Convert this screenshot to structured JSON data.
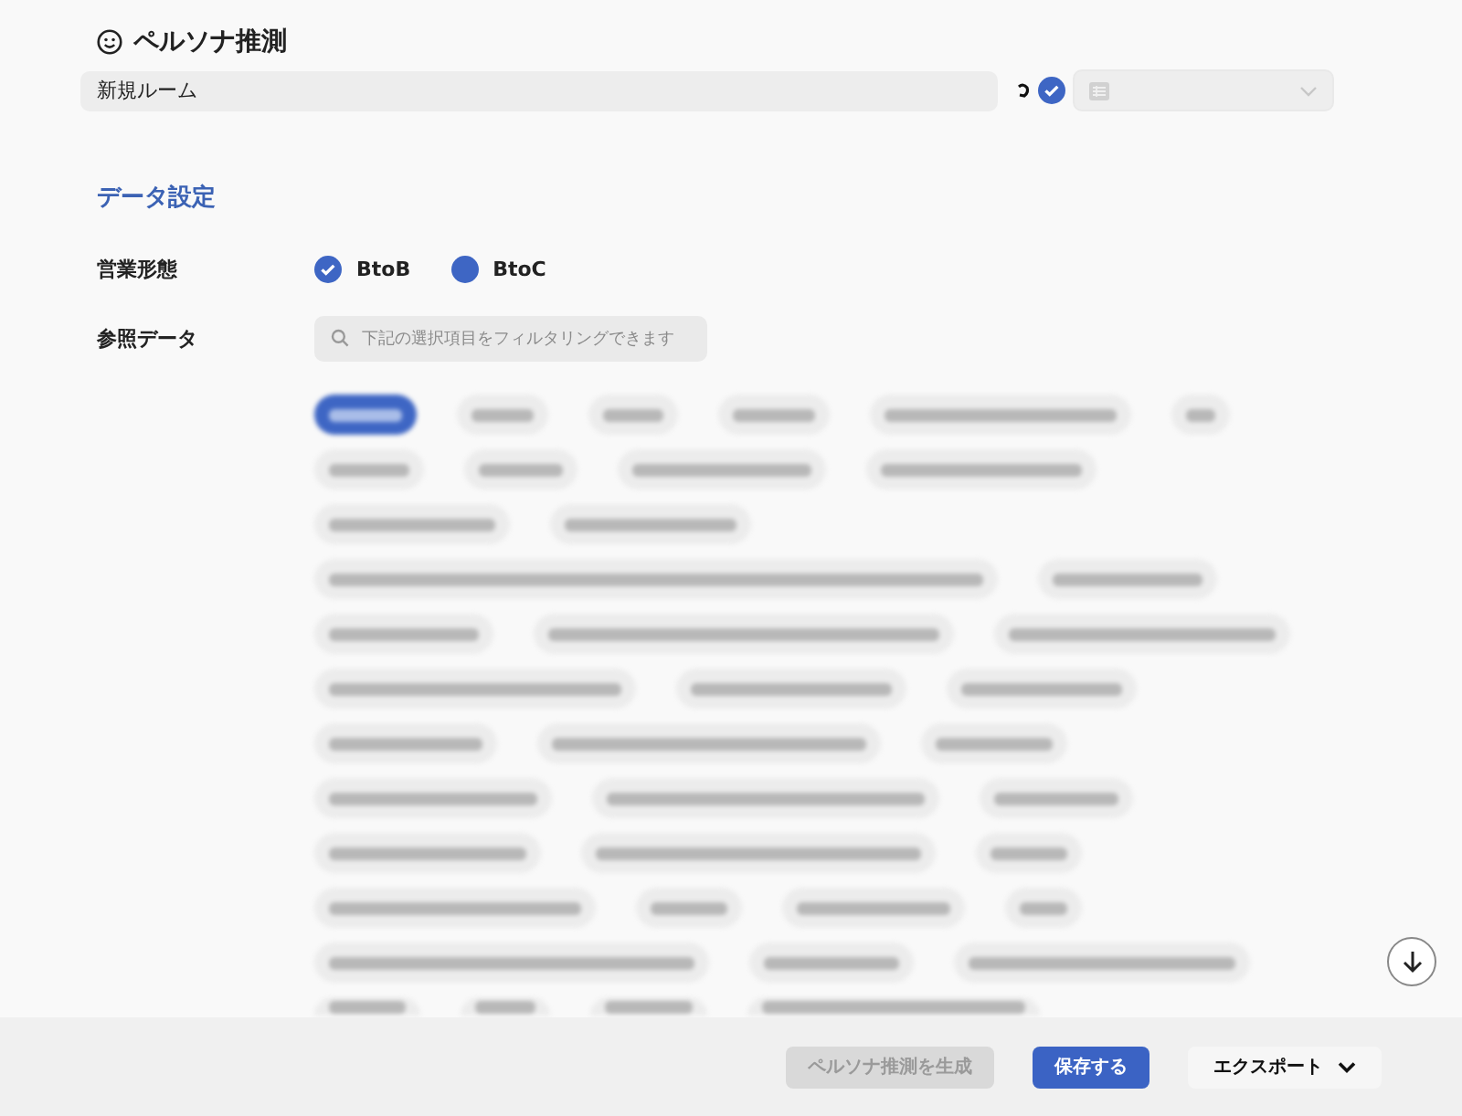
{
  "header": {
    "title": "ペルソナ推測"
  },
  "room_name": {
    "value": "新規ルーム"
  },
  "room_select": {
    "disabled": true
  },
  "data_settings": {
    "heading": "データ設定",
    "business_type": {
      "label": "営業形態",
      "options": [
        {
          "label": "BtoB",
          "checked": true
        },
        {
          "label": "BtoC",
          "checked": false
        }
      ]
    },
    "reference_data": {
      "label": "参照データ",
      "filter": {
        "placeholder": "下記の選択項目をフィルタリングできます"
      },
      "chips": [
        {
          "selected": true
        },
        {
          "selected": false
        },
        {
          "selected": false
        },
        {
          "selected": false
        },
        {
          "selected": false
        },
        {
          "selected": false
        },
        {
          "selected": false
        },
        {
          "selected": false
        },
        {
          "selected": false
        },
        {
          "selected": false
        },
        {
          "selected": false
        },
        {
          "selected": false
        },
        {
          "selected": false
        },
        {
          "selected": false
        },
        {
          "selected": false
        },
        {
          "selected": false
        },
        {
          "selected": false
        },
        {
          "selected": false
        },
        {
          "selected": false
        },
        {
          "selected": false
        },
        {
          "selected": false
        },
        {
          "selected": false
        },
        {
          "selected": false
        },
        {
          "selected": false
        },
        {
          "selected": false
        },
        {
          "selected": false
        },
        {
          "selected": false
        },
        {
          "selected": false
        },
        {
          "selected": false
        },
        {
          "selected": false
        },
        {
          "selected": false
        },
        {
          "selected": false
        },
        {
          "selected": false
        },
        {
          "selected": false
        },
        {
          "selected": false
        },
        {
          "selected": false
        },
        {
          "selected": false,
          "cut_off": true
        },
        {
          "selected": false,
          "cut_off": true
        },
        {
          "selected": false,
          "cut_off": true
        },
        {
          "selected": false,
          "cut_off": true
        }
      ]
    }
  },
  "footer": {
    "buttons": [
      {
        "label": "ペルソナ推測を生成",
        "kind": "generate",
        "disabled": true
      },
      {
        "label": "保存する",
        "kind": "primary",
        "disabled": false
      },
      {
        "label": "エクスポート",
        "kind": "menu",
        "disabled": false
      }
    ]
  }
}
